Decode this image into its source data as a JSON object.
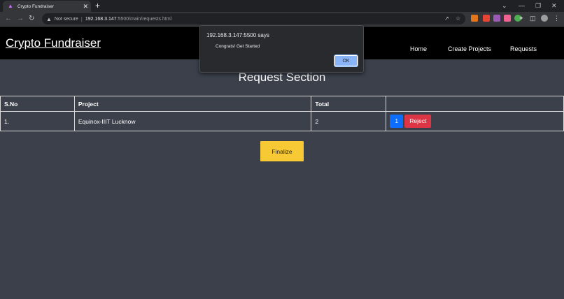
{
  "browser": {
    "tab_title": "Crypto Fundraiser",
    "not_secure": "Not secure",
    "url_host": "192.168.3.147",
    "url_rest": ":5500/main/requests.html"
  },
  "navbar": {
    "brand": "Crypto Fundraiser",
    "links": [
      "Home",
      "Create Projects",
      "Requests"
    ]
  },
  "main": {
    "title": "Request Section",
    "table": {
      "headers": [
        "S.No",
        "Project",
        "Total",
        ""
      ],
      "rows": [
        {
          "sno": "1.",
          "project": "Equinox-IIIT Lucknow",
          "total": "2",
          "vote_label": "1",
          "reject_label": "Reject"
        }
      ]
    },
    "finalize_label": "Finalize"
  },
  "dialog": {
    "title": "192.168.3.147:5500 says",
    "message": "Congrats! Get Started",
    "ok_label": "OK"
  },
  "colors": {
    "page_bg": "#3b404b",
    "navbar_bg": "#000000",
    "vote_button": "#0d6efd",
    "reject_button": "#dc3545",
    "finalize_button": "#f7c934"
  }
}
